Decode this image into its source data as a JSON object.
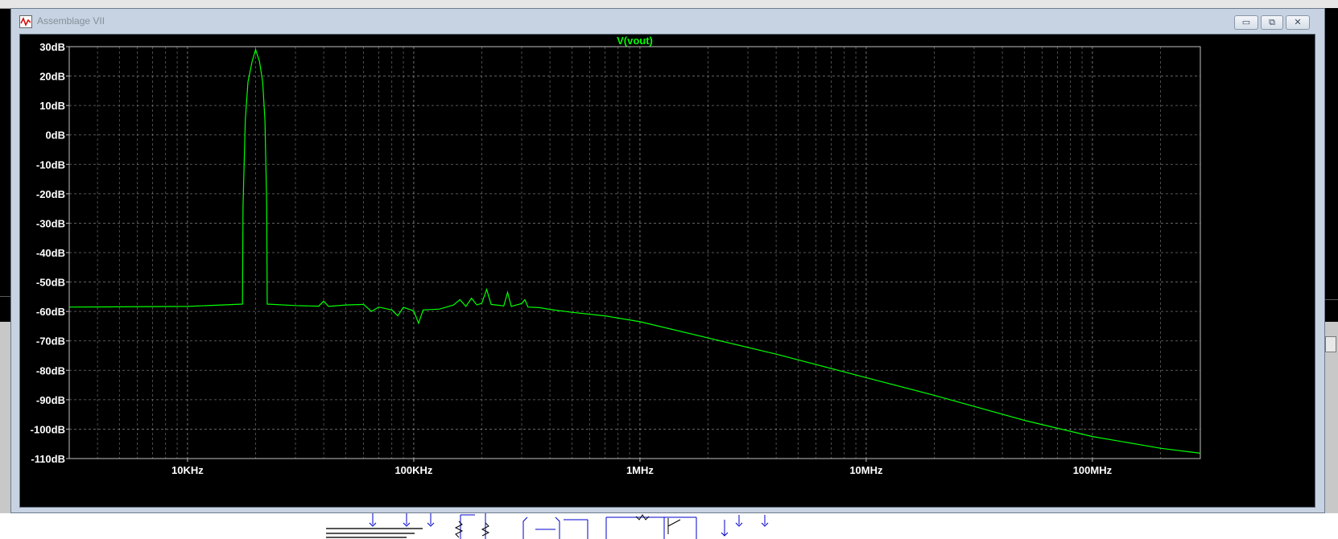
{
  "window": {
    "title": "Assemblage VII",
    "buttons": {
      "minimize": "▭",
      "maximize": "⧉",
      "close": "✕"
    }
  },
  "colors": {
    "trace": "#00ff00",
    "grid": "#a0a0a0",
    "plot_bg": "#000000"
  },
  "chart_data": {
    "type": "line",
    "title": "V(vout)",
    "xscale": "log",
    "xlim": [
      3000,
      300000000
    ],
    "ylim": [
      -110,
      30
    ],
    "grid": true,
    "xticks": [
      {
        "value": 10000,
        "label": "10KHz"
      },
      {
        "value": 100000,
        "label": "100KHz"
      },
      {
        "value": 1000000,
        "label": "1MHz"
      },
      {
        "value": 10000000,
        "label": "10MHz"
      },
      {
        "value": 100000000,
        "label": "100MHz"
      }
    ],
    "yticks": [
      {
        "value": 30,
        "label": "30dB"
      },
      {
        "value": 20,
        "label": "20dB"
      },
      {
        "value": 10,
        "label": "10dB"
      },
      {
        "value": 0,
        "label": "0dB"
      },
      {
        "value": -10,
        "label": "-10dB"
      },
      {
        "value": -20,
        "label": "-20dB"
      },
      {
        "value": -30,
        "label": "-30dB"
      },
      {
        "value": -40,
        "label": "-40dB"
      },
      {
        "value": -50,
        "label": "-50dB"
      },
      {
        "value": -60,
        "label": "-60dB"
      },
      {
        "value": -70,
        "label": "-70dB"
      },
      {
        "value": -80,
        "label": "-80dB"
      },
      {
        "value": -90,
        "label": "-90dB"
      },
      {
        "value": -100,
        "label": "-100dB"
      },
      {
        "value": -110,
        "label": "-110dB"
      }
    ],
    "series": [
      {
        "name": "V(vout)",
        "points": [
          [
            3000,
            -58.5
          ],
          [
            10000,
            -58.3
          ],
          [
            17500,
            -57.5
          ],
          [
            17600,
            -24
          ],
          [
            18000,
            5
          ],
          [
            18500,
            18
          ],
          [
            19300,
            25
          ],
          [
            20000,
            29
          ],
          [
            20800,
            25
          ],
          [
            21500,
            18
          ],
          [
            22000,
            5
          ],
          [
            22400,
            -24
          ],
          [
            22500,
            -57.5
          ],
          [
            30000,
            -58.0
          ],
          [
            38000,
            -58.2
          ],
          [
            40000,
            -56.5
          ],
          [
            42000,
            -58.3
          ],
          [
            50000,
            -57.8
          ],
          [
            60000,
            -57.6
          ],
          [
            65000,
            -60
          ],
          [
            70000,
            -58.5
          ],
          [
            80000,
            -59.5
          ],
          [
            85000,
            -61.5
          ],
          [
            90000,
            -58.6
          ],
          [
            100000,
            -59.8
          ],
          [
            105000,
            -64
          ],
          [
            110000,
            -59.5
          ],
          [
            130000,
            -59.2
          ],
          [
            150000,
            -57.8
          ],
          [
            160000,
            -56
          ],
          [
            170000,
            -58.3
          ],
          [
            180000,
            -55.5
          ],
          [
            190000,
            -57.8
          ],
          [
            200000,
            -57.2
          ],
          [
            210000,
            -52.5
          ],
          [
            220000,
            -57.6
          ],
          [
            250000,
            -58.1
          ],
          [
            260000,
            -53.5
          ],
          [
            270000,
            -58.3
          ],
          [
            300000,
            -57.3
          ],
          [
            310000,
            -56
          ],
          [
            320000,
            -58.5
          ],
          [
            360000,
            -58.7
          ],
          [
            400000,
            -59.3
          ],
          [
            500000,
            -60.3
          ],
          [
            700000,
            -61.5
          ],
          [
            1000000,
            -63.5
          ],
          [
            2000000,
            -69.0
          ],
          [
            4000000,
            -74.5
          ],
          [
            10000000,
            -82.5
          ],
          [
            20000000,
            -88.5
          ],
          [
            50000000,
            -97.0
          ],
          [
            100000000,
            -102.5
          ],
          [
            200000000,
            -106.5
          ],
          [
            300000000,
            -108.2
          ]
        ]
      }
    ]
  },
  "background": {
    "schematic_note": ""
  }
}
